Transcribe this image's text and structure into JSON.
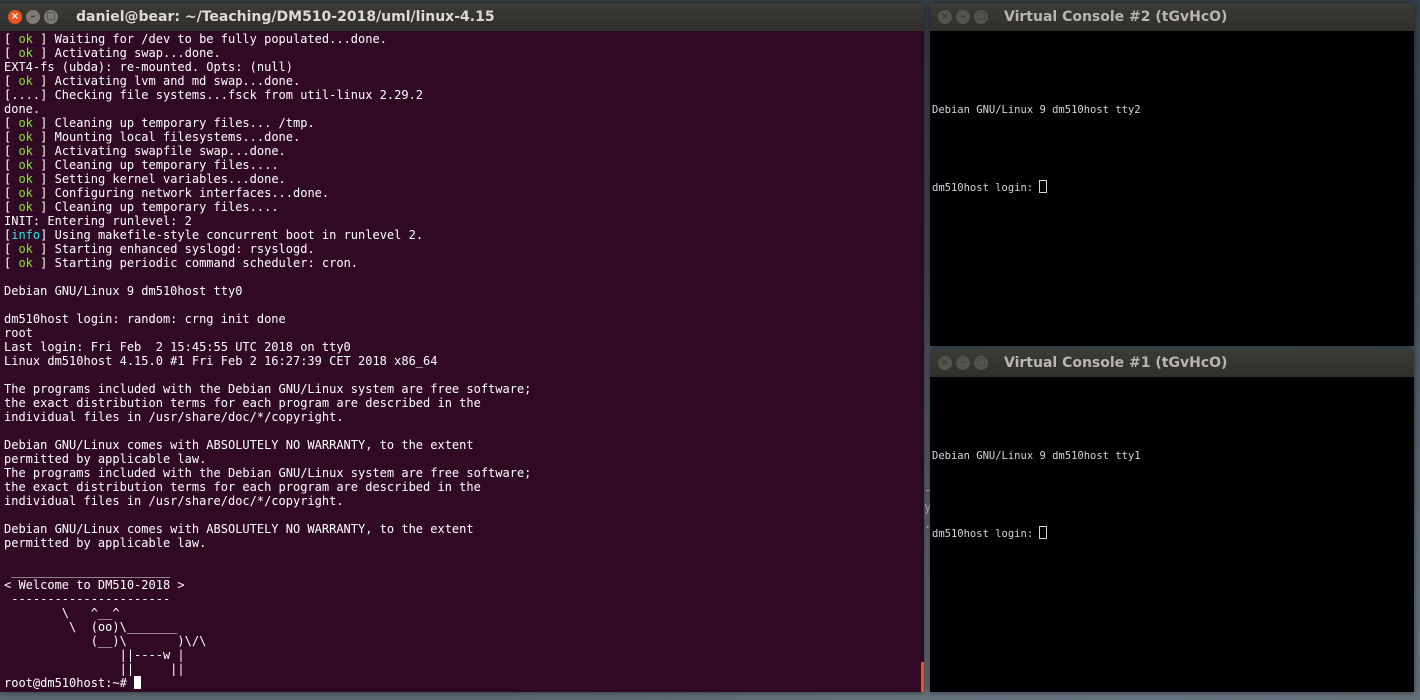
{
  "main_terminal": {
    "title": "daniel@bear: ~/Teaching/DM510-2018/uml/linux-4.15",
    "lines": [
      {
        "tag": "[ ",
        "status": "ok",
        "end": " ] ",
        "text": "Waiting for /dev to be fully populated...done."
      },
      {
        "tag": "[ ",
        "status": "ok",
        "end": " ] ",
        "text": "Activating swap...done."
      },
      {
        "text": "EXT4-fs (ubda): re-mounted. Opts: (null)"
      },
      {
        "tag": "[ ",
        "status": "ok",
        "end": " ] ",
        "text": "Activating lvm and md swap...done."
      },
      {
        "text": "[....] Checking file systems...fsck from util-linux 2.29.2"
      },
      {
        "text": "done."
      },
      {
        "tag": "[ ",
        "status": "ok",
        "end": " ] ",
        "text": "Cleaning up temporary files... /tmp."
      },
      {
        "tag": "[ ",
        "status": "ok",
        "end": " ] ",
        "text": "Mounting local filesystems...done."
      },
      {
        "tag": "[ ",
        "status": "ok",
        "end": " ] ",
        "text": "Activating swapfile swap...done."
      },
      {
        "tag": "[ ",
        "status": "ok",
        "end": " ] ",
        "text": "Cleaning up temporary files...."
      },
      {
        "tag": "[ ",
        "status": "ok",
        "end": " ] ",
        "text": "Setting kernel variables...done."
      },
      {
        "tag": "[ ",
        "status": "ok",
        "end": " ] ",
        "text": "Configuring network interfaces...done."
      },
      {
        "tag": "[ ",
        "status": "ok",
        "end": " ] ",
        "text": "Cleaning up temporary files...."
      },
      {
        "text": "INIT: Entering runlevel: 2"
      },
      {
        "tag": "[",
        "status": "info",
        "end": "] ",
        "text": "Using makefile-style concurrent boot in runlevel 2."
      },
      {
        "tag": "[ ",
        "status": "ok",
        "end": " ] ",
        "text": "Starting enhanced syslogd: rsyslogd."
      },
      {
        "tag": "[ ",
        "status": "ok",
        "end": " ] ",
        "text": "Starting periodic command scheduler: cron."
      },
      {
        "text": ""
      },
      {
        "text": "Debian GNU/Linux 9 dm510host tty0"
      },
      {
        "text": ""
      },
      {
        "text": "dm510host login: random: crng init done"
      },
      {
        "text": "root"
      },
      {
        "text": "Last login: Fri Feb  2 15:45:55 UTC 2018 on tty0"
      },
      {
        "text": "Linux dm510host 4.15.0 #1 Fri Feb 2 16:27:39 CET 2018 x86_64"
      },
      {
        "text": ""
      },
      {
        "text": "The programs included with the Debian GNU/Linux system are free software;"
      },
      {
        "text": "the exact distribution terms for each program are described in the"
      },
      {
        "text": "individual files in /usr/share/doc/*/copyright."
      },
      {
        "text": ""
      },
      {
        "text": "Debian GNU/Linux comes with ABSOLUTELY NO WARRANTY, to the extent"
      },
      {
        "text": "permitted by applicable law."
      },
      {
        "text": "The programs included with the Debian GNU/Linux system are free software;"
      },
      {
        "text": "the exact distribution terms for each program are described in the"
      },
      {
        "text": "individual files in /usr/share/doc/*/copyright."
      },
      {
        "text": ""
      },
      {
        "text": "Debian GNU/Linux comes with ABSOLUTELY NO WARRANTY, to the extent"
      },
      {
        "text": "permitted by applicable law."
      },
      {
        "text": ""
      },
      {
        "text": " ______________________"
      },
      {
        "text": "< Welcome to DM510-2018 >"
      },
      {
        "text": " ----------------------"
      },
      {
        "text": "        \\   ^__^"
      },
      {
        "text": "         \\  (oo)\\_______"
      },
      {
        "text": "            (__)\\       )\\/\\"
      },
      {
        "text": "                ||----w |"
      },
      {
        "text": "                ||     ||"
      }
    ],
    "prompt": "root@dm510host:~# "
  },
  "vc2": {
    "title": "Virtual Console #2 (tGvHcO)",
    "banner": "Debian GNU/Linux 9 dm510host tty2",
    "login_prompt": "dm510host login: "
  },
  "vc1": {
    "title": "Virtual Console #1 (tGvHcO)",
    "banner": "Debian GNU/Linux 9 dm510host tty1",
    "login_prompt": "dm510host login: "
  },
  "window_buttons": {
    "close": "×",
    "minimize": "–",
    "maximize": "□"
  },
  "background_glyphs": [
    "-",
    "y",
    "."
  ],
  "colors": {
    "terminal_bg": "#300a24",
    "ok": "#8ae234",
    "info": "#34e2e2",
    "accent": "#e95420"
  }
}
